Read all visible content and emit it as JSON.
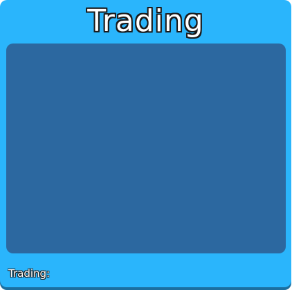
{
  "window": {
    "title": "Trading"
  },
  "footer": {
    "trading_label": "Trading:"
  },
  "colors": {
    "panel_background": "#2ab5fc",
    "content_background": "#2c68a0",
    "text": "#ffffff",
    "text_outline": "#1a1a1a"
  }
}
